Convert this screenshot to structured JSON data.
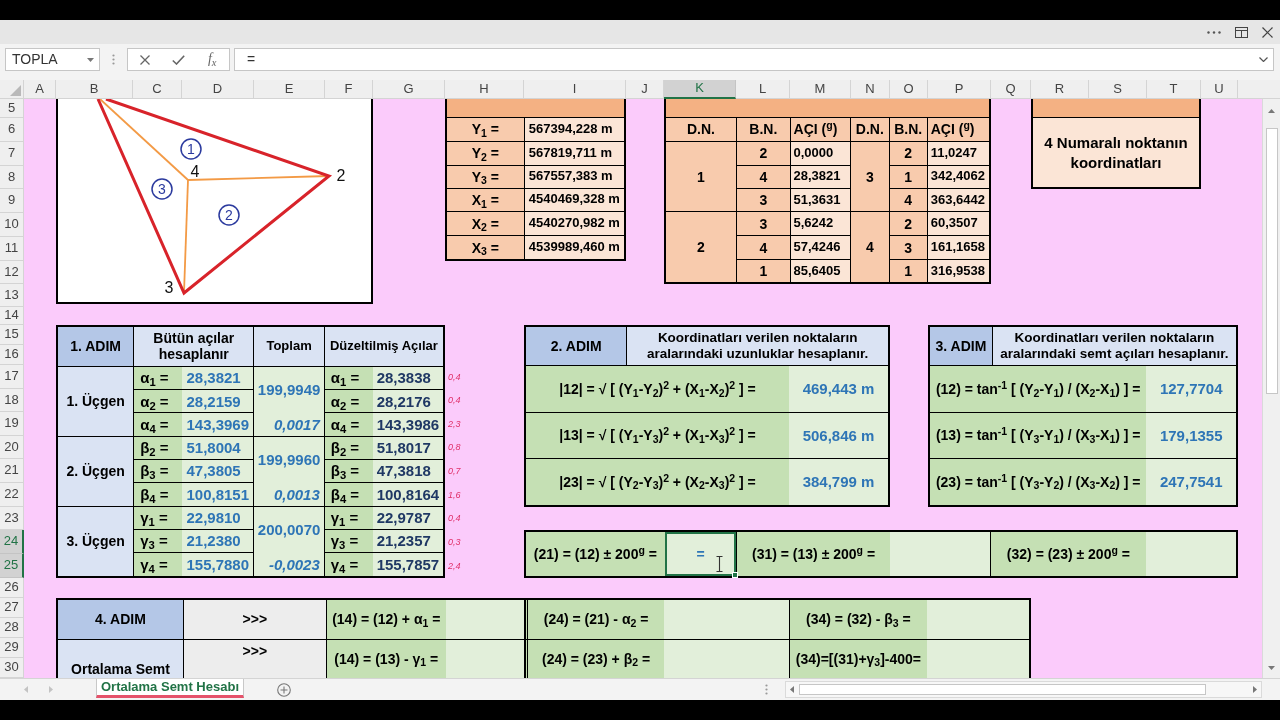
{
  "formula_bar": {
    "name_box": "TOPLA",
    "function_label": "f$_{x}$",
    "formula": "="
  },
  "column_headers": [
    {
      "label": "A",
      "selected": false
    },
    {
      "label": "B",
      "selected": false
    },
    {
      "label": "C",
      "selected": false
    },
    {
      "label": "D",
      "selected": false
    },
    {
      "label": "E",
      "selected": false
    },
    {
      "label": "F",
      "selected": false
    },
    {
      "label": "G",
      "selected": false
    },
    {
      "label": "H",
      "selected": false
    },
    {
      "label": "I",
      "selected": false
    },
    {
      "label": "J",
      "selected": false
    },
    {
      "label": "K",
      "selected": true
    },
    {
      "label": "L",
      "selected": false
    },
    {
      "label": "M",
      "selected": false
    },
    {
      "label": "N",
      "selected": false
    },
    {
      "label": "O",
      "selected": false
    },
    {
      "label": "P",
      "selected": false
    },
    {
      "label": "Q",
      "selected": false
    },
    {
      "label": "R",
      "selected": false
    },
    {
      "label": "S",
      "selected": false
    },
    {
      "label": "T",
      "selected": false
    },
    {
      "label": "U",
      "selected": false
    }
  ],
  "row_headers": [
    {
      "label": "5",
      "selected": false
    },
    {
      "label": "6",
      "selected": false
    },
    {
      "label": "7",
      "selected": false
    },
    {
      "label": "8",
      "selected": false
    },
    {
      "label": "9",
      "selected": false
    },
    {
      "label": "10",
      "selected": false
    },
    {
      "label": "11",
      "selected": false
    },
    {
      "label": "12",
      "selected": false
    },
    {
      "label": "13",
      "selected": false
    },
    {
      "label": "14",
      "selected": false
    },
    {
      "label": "15",
      "selected": false
    },
    {
      "label": "16",
      "selected": false
    },
    {
      "label": "17",
      "selected": false
    },
    {
      "label": "18",
      "selected": false
    },
    {
      "label": "19",
      "selected": false
    },
    {
      "label": "20",
      "selected": false
    },
    {
      "label": "21",
      "selected": false
    },
    {
      "label": "22",
      "selected": false
    },
    {
      "label": "23",
      "selected": false
    },
    {
      "label": "24",
      "selected": true
    },
    {
      "label": "25",
      "selected": true
    },
    {
      "label": "26",
      "selected": false
    },
    {
      "label": "27",
      "selected": false
    },
    {
      "label": "28",
      "selected": false
    },
    {
      "label": "29",
      "selected": false
    },
    {
      "label": "30",
      "selected": false
    }
  ],
  "diagram": {
    "point_labels": [
      "2",
      "3",
      "4"
    ],
    "region_labels": [
      "1",
      "2",
      "3"
    ]
  },
  "given": [
    {
      "label": "Y$_{1}$ =",
      "value": "567394,228 m"
    },
    {
      "label": "Y$_{2}$ =",
      "value": "567819,711 m"
    },
    {
      "label": "Y$_{3}$ =",
      "value": "567557,383 m"
    },
    {
      "label": "X$_{1}$ =",
      "value": "4540469,328 m"
    },
    {
      "label": "X$_{2}$ =",
      "value": "4540270,982 m"
    },
    {
      "label": "X$_{3}$ =",
      "value": "4539989,460 m"
    }
  ],
  "measured": {
    "columns": [
      "D.N.",
      "B.N.",
      "AÇI ($^{g}$)",
      "D.N.",
      "B.N.",
      "AÇI ($^{g}$)"
    ],
    "stations": [
      {
        "number": "1",
        "targets": [
          {
            "point": "2",
            "angle": "0,0000"
          },
          {
            "point": "4",
            "angle": "28,3821"
          },
          {
            "point": "3",
            "angle": "51,3631"
          }
        ]
      },
      {
        "number": "3",
        "targets": [
          {
            "point": "2",
            "angle": "11,0247"
          },
          {
            "point": "1",
            "angle": "342,4062"
          },
          {
            "point": "4",
            "angle": "363,6442"
          }
        ]
      },
      {
        "number": "2",
        "targets": [
          {
            "point": "3",
            "angle": "5,6242"
          },
          {
            "point": "4",
            "angle": "57,4246"
          },
          {
            "point": "1",
            "angle": "85,6405"
          }
        ]
      },
      {
        "number": "4",
        "targets": [
          {
            "point": "2",
            "angle": "60,3507"
          },
          {
            "point": "3",
            "angle": "161,1658"
          },
          {
            "point": "1",
            "angle": "316,9538"
          }
        ]
      }
    ]
  },
  "required": {
    "text": "4 Numaralı noktanın koordinatları"
  },
  "step1": {
    "title": "1. ADIM",
    "columns": [
      "Bütün açılar hesaplanır",
      "Toplam",
      "Düzeltilmiş Açılar"
    ],
    "groups": [
      {
        "label": "1. Üçgen",
        "sum": "199,9949",
        "misclosure": "0,0017",
        "angles": [
          {
            "symbol": "α$_{1}$ =",
            "value": "28,3821",
            "corrected_symbol": "α$_{1}$ =",
            "corrected": "28,3838",
            "note": "0,4"
          },
          {
            "symbol": "α$_{2}$ =",
            "value": "28,2159",
            "corrected_symbol": "α$_{2}$ =",
            "corrected": "28,2176",
            "note": "0,4"
          },
          {
            "symbol": "α$_{4}$ =",
            "value": "143,3969",
            "corrected_symbol": "α$_{4}$ =",
            "corrected": "143,3986",
            "note": "2,3"
          }
        ]
      },
      {
        "label": "2. Üçgen",
        "sum": "199,9960",
        "misclosure": "0,0013",
        "angles": [
          {
            "symbol": "β$_{2}$ =",
            "value": "51,8004",
            "corrected_symbol": "β$_{2}$ =",
            "corrected": "51,8017",
            "note": "0,8"
          },
          {
            "symbol": "β$_{3}$ =",
            "value": "47,3805",
            "corrected_symbol": "β$_{3}$ =",
            "corrected": "47,3818",
            "note": "0,7"
          },
          {
            "symbol": "β$_{4}$ =",
            "value": "100,8151",
            "corrected_symbol": "β$_{4}$ =",
            "corrected": "100,8164",
            "note": "1,6"
          }
        ]
      },
      {
        "label": "3. Üçgen",
        "sum": "200,0070",
        "misclosure": "-0,0023",
        "angles": [
          {
            "symbol": "γ$_{1}$ =",
            "value": "22,9810",
            "corrected_symbol": "γ$_{1}$ =",
            "corrected": "22,9787",
            "note": "0,4"
          },
          {
            "symbol": "γ$_{3}$ =",
            "value": "21,2380",
            "corrected_symbol": "γ$_{3}$ =",
            "corrected": "21,2357",
            "note": "0,3"
          },
          {
            "symbol": "γ$_{4}$ =",
            "value": "155,7880",
            "corrected_symbol": "γ$_{4}$ =",
            "corrected": "155,7857",
            "note": "2,4"
          }
        ]
      }
    ]
  },
  "step2": {
    "title": "2. ADIM",
    "description": "Koordinatları verilen noktaların aralarındaki uzunluklar hesaplanır.",
    "rows": [
      {
        "formula": "|12| = √ [ (Y$_{1}$-Y$_{2}$)$^{2}$ + (X$_{1}$-X$_{2}$)$^{2}$ ] =",
        "result": "469,443 m"
      },
      {
        "formula": "|13| = √ [ (Y$_{1}$-Y$_{3}$)$^{2}$ + (X$_{1}$-X$_{3}$)$^{2}$ ] =",
        "result": "506,846 m"
      },
      {
        "formula": "|23| = √ [ (Y$_{2}$-Y$_{3}$)$^{2}$ + (X$_{2}$-X$_{3}$)$^{2}$ ] =",
        "result": "384,799 m"
      }
    ]
  },
  "step3": {
    "title": "3. ADIM",
    "description": "Koordinatları verilen noktaların aralarındaki semt açıları hesaplanır.",
    "rows": [
      {
        "formula": "(12) = tan$^{-1}$ [ (Y$_{2}$-Y$_{1}$) / (X$_{2}$-X$_{1}$) ] =",
        "result": "127,7704"
      },
      {
        "formula": "(13) = tan$^{-1}$ [ (Y$_{3}$-Y$_{1}$) / (X$_{3}$-X$_{1}$) ] =",
        "result": "179,1355"
      },
      {
        "formula": "(23) = tan$^{-1}$ [ (Y$_{3}$-Y$_{2}$) / (X$_{3}$-X$_{2}$) ] =",
        "result": "247,7541"
      }
    ]
  },
  "back_bearings": [
    {
      "formula": "(21) = (12) ± 200$^{g}$ =",
      "value": "=",
      "selected": true
    },
    {
      "formula": "(31) = (13) ± 200$^{g}$ =",
      "selected": false
    },
    {
      "formula": "(32) = (23) ± 200$^{g}$ =",
      "selected": false
    }
  ],
  "step4": {
    "rows": [
      {
        "label": "4. ADIM",
        "arrow": ">>>",
        "formulas": [
          "(14) = (12) + α$_{1}$ =",
          "(24) = (21) - α$_{2}$ =",
          "(34) = (32) - β$_{3}$ ="
        ]
      },
      {
        "label": "Ortalama Semt",
        "arrow": ">>>",
        "formulas": [
          "(14) = (13) - γ$_{1}$ =",
          "(24) = (23) + β$_{2}$ =",
          "(34)=[(31)+γ$_{3}$]-400="
        ]
      }
    ]
  },
  "sheet_tabs": [
    {
      "label": "Ortalama Semt Hesabı",
      "selected": true
    }
  ]
}
